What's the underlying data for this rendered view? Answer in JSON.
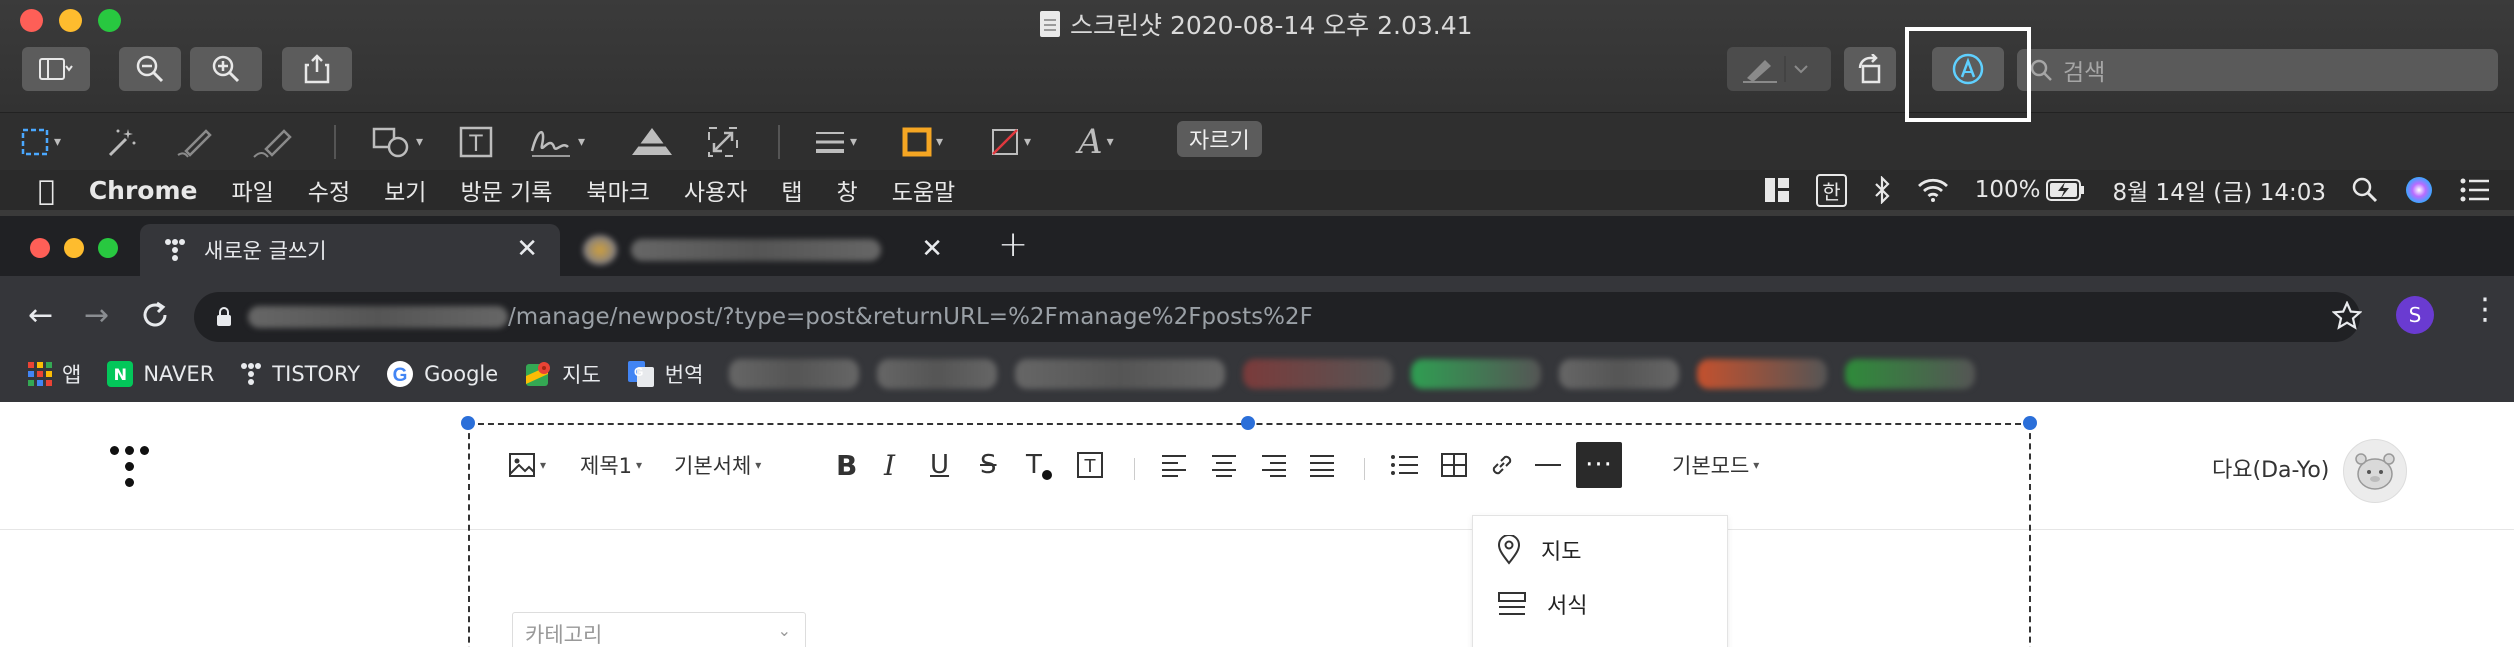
{
  "preview": {
    "window_title": "스크린샷 2020-08-14 오후 2.03.41",
    "search_placeholder": "검색",
    "crop_label": "자르기"
  },
  "menubar": {
    "app": "Chrome",
    "items": [
      "파일",
      "수정",
      "보기",
      "방문 기록",
      "북마크",
      "사용자",
      "탭",
      "창",
      "도움말"
    ],
    "input_source": "한",
    "battery": "100%",
    "datetime": "8월 14일 (금) 14:03"
  },
  "chrome": {
    "active_tab_title": "새로운 글쓰기",
    "url_visible": "/manage/newpost/?type=post&returnURL=%2Fmanage%2Fposts%2F",
    "profile_initial": "S",
    "bookmarks": [
      "앱",
      "NAVER",
      "TISTORY",
      "Google",
      "지도",
      "번역"
    ]
  },
  "editor": {
    "toolbar": {
      "heading": "제목1",
      "font": "기본서체",
      "mode": "기본모드",
      "more": "···"
    },
    "more_menu": [
      "지도",
      "서식"
    ],
    "category_placeholder": "카테고리",
    "user_name": "다요(Da-Yo)"
  },
  "colors": {
    "preview_bg": "#353535",
    "menubar_bg": "#2a2a2a",
    "chrome_tab_bg": "#202124",
    "chrome_toolbar_bg": "#35363a",
    "selection_handle": "#2b6fd9",
    "highlight_border": "#ffffff",
    "naver_green": "#03c75a"
  }
}
